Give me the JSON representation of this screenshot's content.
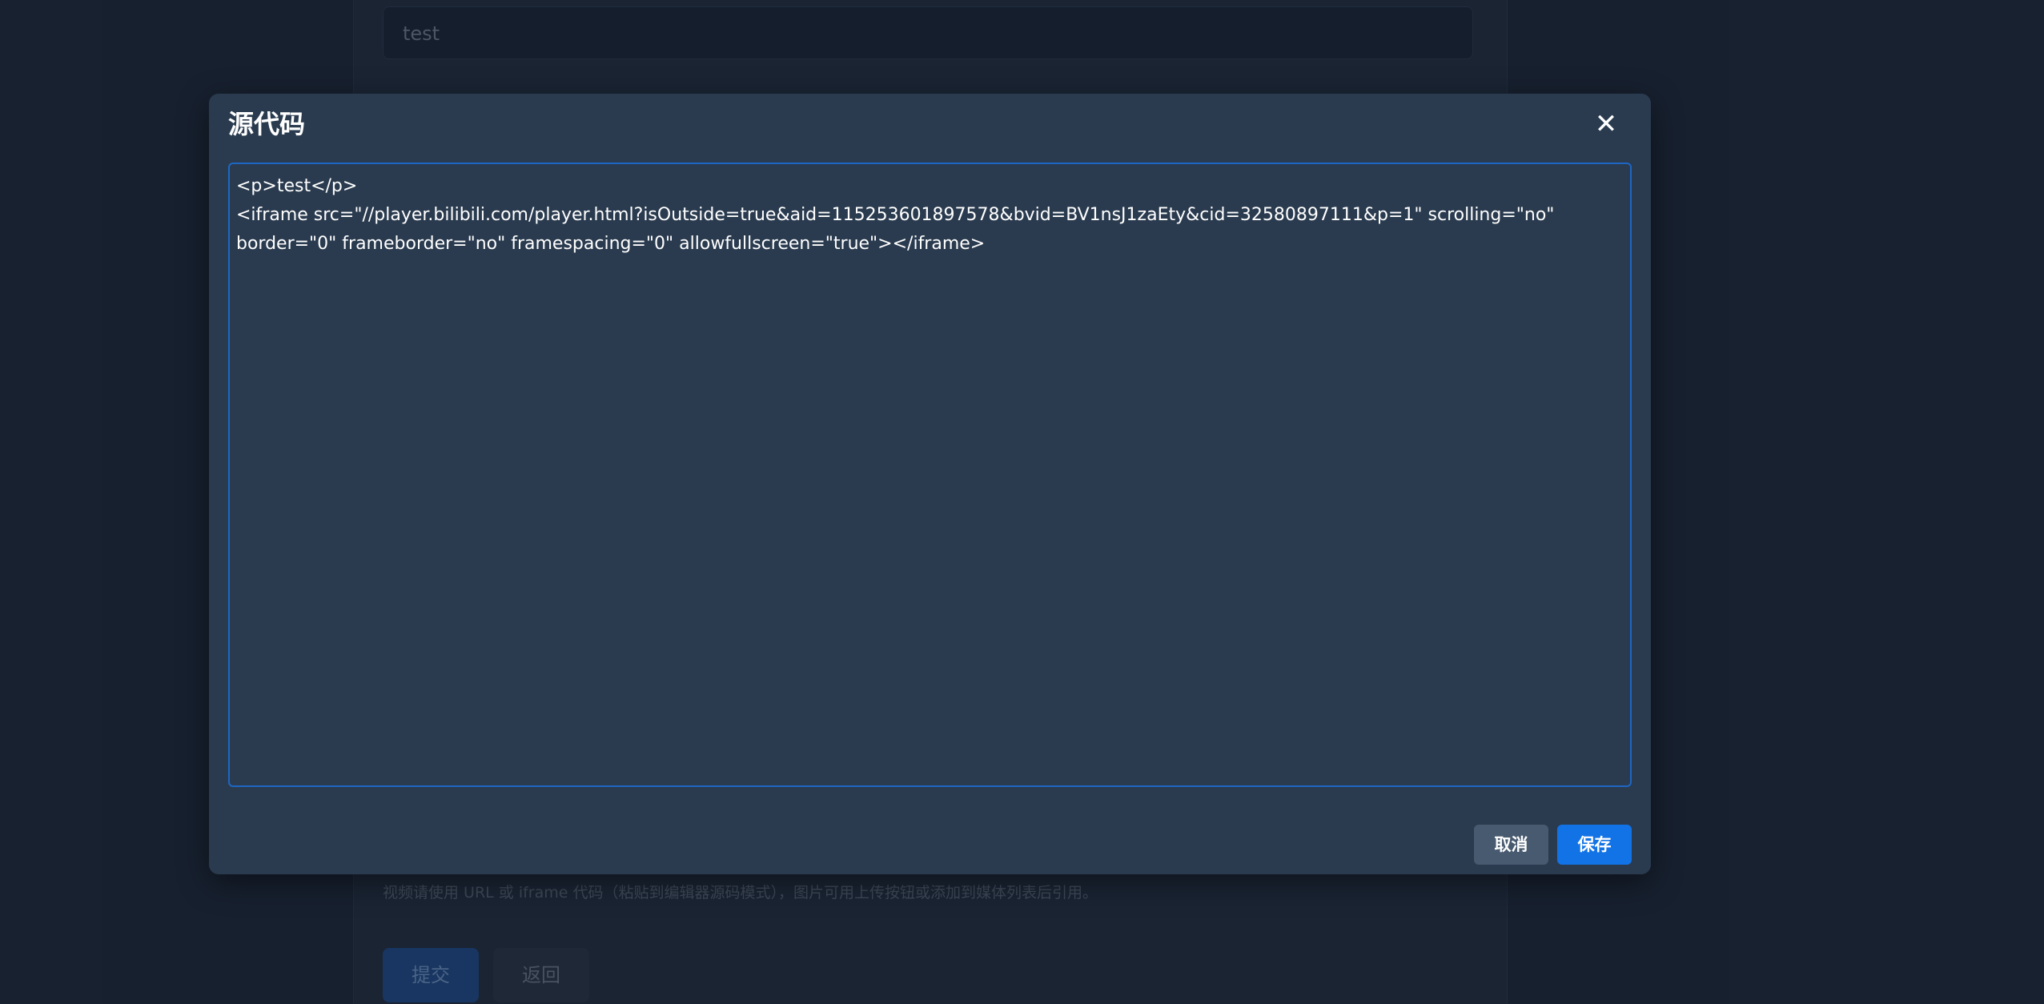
{
  "background": {
    "title_value": "test",
    "hint": "视频请使用 URL 或 iframe 代码（粘贴到编辑器源码模式），图片可用上传按钮或添加到媒体列表后引用。",
    "submit_label": "提交",
    "back_label": "返回"
  },
  "modal": {
    "title": "源代码",
    "close_icon": "close-icon",
    "source_code": "<p>test</p>\n<iframe src=\"//player.bilibili.com/player.html?isOutside=true&aid=115253601897578&bvid=BV1nsJ1zaEty&cid=32580897111&p=1\" scrolling=\"no\" border=\"0\" frameborder=\"no\" framespacing=\"0\" allowfullscreen=\"true\"></iframe>",
    "cancel_label": "取消",
    "save_label": "保存"
  },
  "colors": {
    "accent": "#1273e6",
    "modal_bg": "#2a3b4f",
    "page_bg": "#1e2939"
  }
}
